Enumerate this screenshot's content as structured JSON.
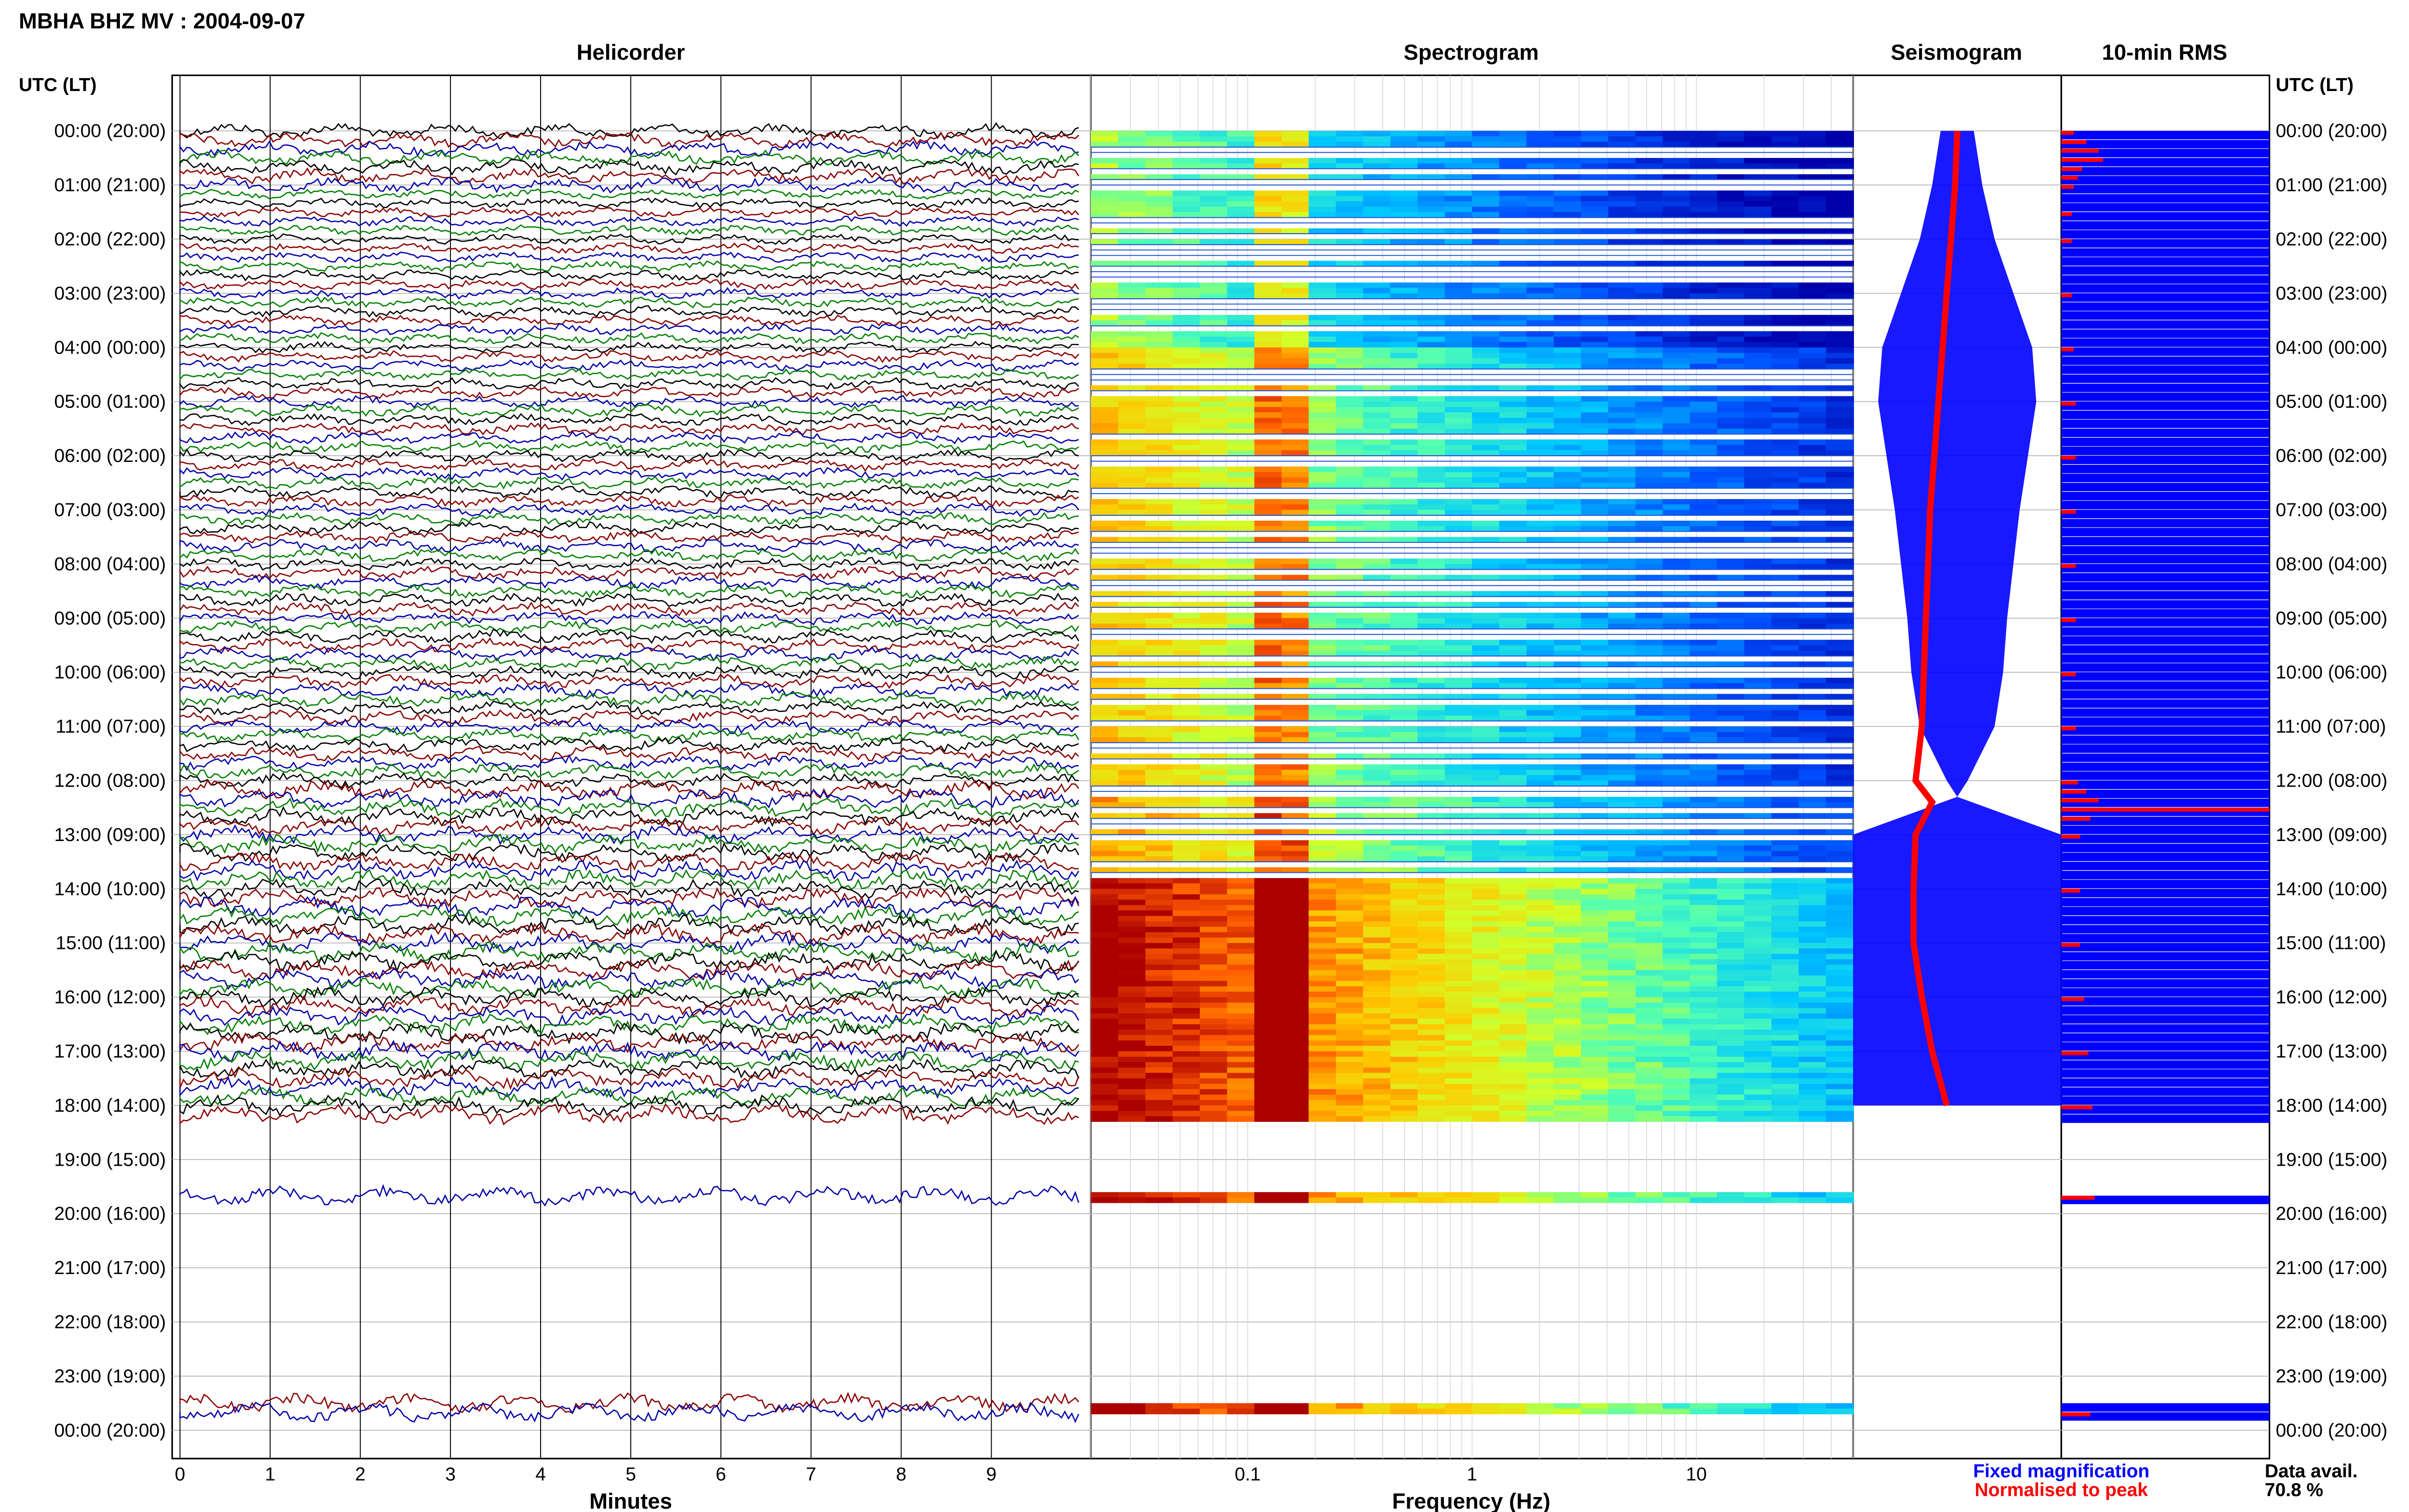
{
  "header": {
    "title": "MBHA BHZ MV : 2004-09-07"
  },
  "panels": {
    "helicorder": "Helicorder",
    "spectrogram": "Spectrogram",
    "seismogram": "Seismogram",
    "rms": "10-min RMS"
  },
  "axis_labels": {
    "left_time": "UTC (LT)",
    "right_time": "UTC (LT)",
    "helicorder_x": "Minutes",
    "spectrogram_x": "Frequency (Hz)"
  },
  "legend": {
    "fixed": "Fixed magnification",
    "normalised": "Normalised to peak",
    "fixed_color": "#0000ff",
    "normalised_color": "#ff0000"
  },
  "availability": {
    "label": "Data avail.",
    "value": "70.8 %"
  },
  "chart_data": {
    "type": "composite",
    "time_rows": [
      "00:00 (20:00)",
      "01:00 (21:00)",
      "02:00 (22:00)",
      "03:00 (23:00)",
      "04:00 (00:00)",
      "05:00 (01:00)",
      "06:00 (02:00)",
      "07:00 (03:00)",
      "08:00 (04:00)",
      "09:00 (05:00)",
      "10:00 (06:00)",
      "11:00 (07:00)",
      "12:00 (08:00)",
      "13:00 (09:00)",
      "14:00 (10:00)",
      "15:00 (11:00)",
      "16:00 (12:00)",
      "17:00 (13:00)",
      "18:00 (14:00)",
      "19:00 (15:00)",
      "20:00 (16:00)",
      "21:00 (17:00)",
      "22:00 (18:00)",
      "23:00 (19:00)",
      "00:00 (20:00)"
    ],
    "helicorder": {
      "x_ticks": [
        "0",
        "1",
        "2",
        "3",
        "4",
        "5",
        "6",
        "7",
        "8",
        "9"
      ],
      "xlim": [
        0,
        10
      ],
      "trace_colors": [
        "#000000",
        "#8b0000",
        "#0000aa",
        "#008000"
      ]
    },
    "spectrogram": {
      "x_scale": "log",
      "xlim": [
        0.02,
        50
      ],
      "x_ticks": [
        "0.1",
        "1",
        "10"
      ]
    },
    "data_coverage_hours": [
      [
        0,
        18.3
      ],
      [
        19.6,
        19.8
      ],
      [
        23.5,
        23.7
      ]
    ],
    "seismogram": {
      "fixed_magnification": [
        [
          0,
          0.08
        ],
        [
          1,
          0.12
        ],
        [
          2,
          0.18
        ],
        [
          3,
          0.27
        ],
        [
          4,
          0.36
        ],
        [
          5,
          0.38
        ],
        [
          6,
          0.34
        ],
        [
          7,
          0.3
        ],
        [
          8,
          0.27
        ],
        [
          9,
          0.24
        ],
        [
          10,
          0.22
        ],
        [
          11,
          0.18
        ],
        [
          12,
          0.05
        ],
        [
          12.3,
          0.0
        ],
        [
          13,
          0.5
        ],
        [
          14,
          0.5
        ],
        [
          15,
          0.5
        ],
        [
          16,
          0.5
        ],
        [
          17,
          0.5
        ],
        [
          18,
          0.5
        ]
      ],
      "normalised_to_peak": [
        [
          0,
          0.5
        ],
        [
          1,
          0.49
        ],
        [
          2,
          0.47
        ],
        [
          3,
          0.45
        ],
        [
          4,
          0.43
        ],
        [
          5,
          0.41
        ],
        [
          6,
          0.39
        ],
        [
          7,
          0.37
        ],
        [
          8,
          0.36
        ],
        [
          9,
          0.35
        ],
        [
          10,
          0.34
        ],
        [
          11,
          0.33
        ],
        [
          12,
          0.3
        ],
        [
          12.4,
          0.38
        ],
        [
          13,
          0.3
        ],
        [
          14,
          0.29
        ],
        [
          15,
          0.29
        ],
        [
          16,
          0.33
        ],
        [
          17,
          0.38
        ],
        [
          18,
          0.45
        ]
      ]
    },
    "rms_10min": {
      "normalised_to_peak": [
        [
          0.0,
          0.06
        ],
        [
          0.17,
          0.12
        ],
        [
          0.33,
          0.18
        ],
        [
          0.5,
          0.2
        ],
        [
          0.67,
          0.1
        ],
        [
          0.83,
          0.08
        ],
        [
          1.0,
          0.06
        ],
        [
          1.5,
          0.05
        ],
        [
          2.0,
          0.05
        ],
        [
          3.0,
          0.05
        ],
        [
          4.0,
          0.06
        ],
        [
          5.0,
          0.07
        ],
        [
          6.0,
          0.07
        ],
        [
          7.0,
          0.07
        ],
        [
          8.0,
          0.07
        ],
        [
          9.0,
          0.07
        ],
        [
          10.0,
          0.07
        ],
        [
          11.0,
          0.07
        ],
        [
          12.0,
          0.08
        ],
        [
          12.17,
          0.12
        ],
        [
          12.33,
          0.18
        ],
        [
          12.5,
          1.0
        ],
        [
          12.67,
          0.14
        ],
        [
          13.0,
          0.09
        ],
        [
          14.0,
          0.09
        ],
        [
          15.0,
          0.09
        ],
        [
          16.0,
          0.11
        ],
        [
          17.0,
          0.13
        ],
        [
          18.0,
          0.15
        ],
        [
          19.67,
          0.16
        ],
        [
          23.67,
          0.14
        ]
      ]
    }
  }
}
